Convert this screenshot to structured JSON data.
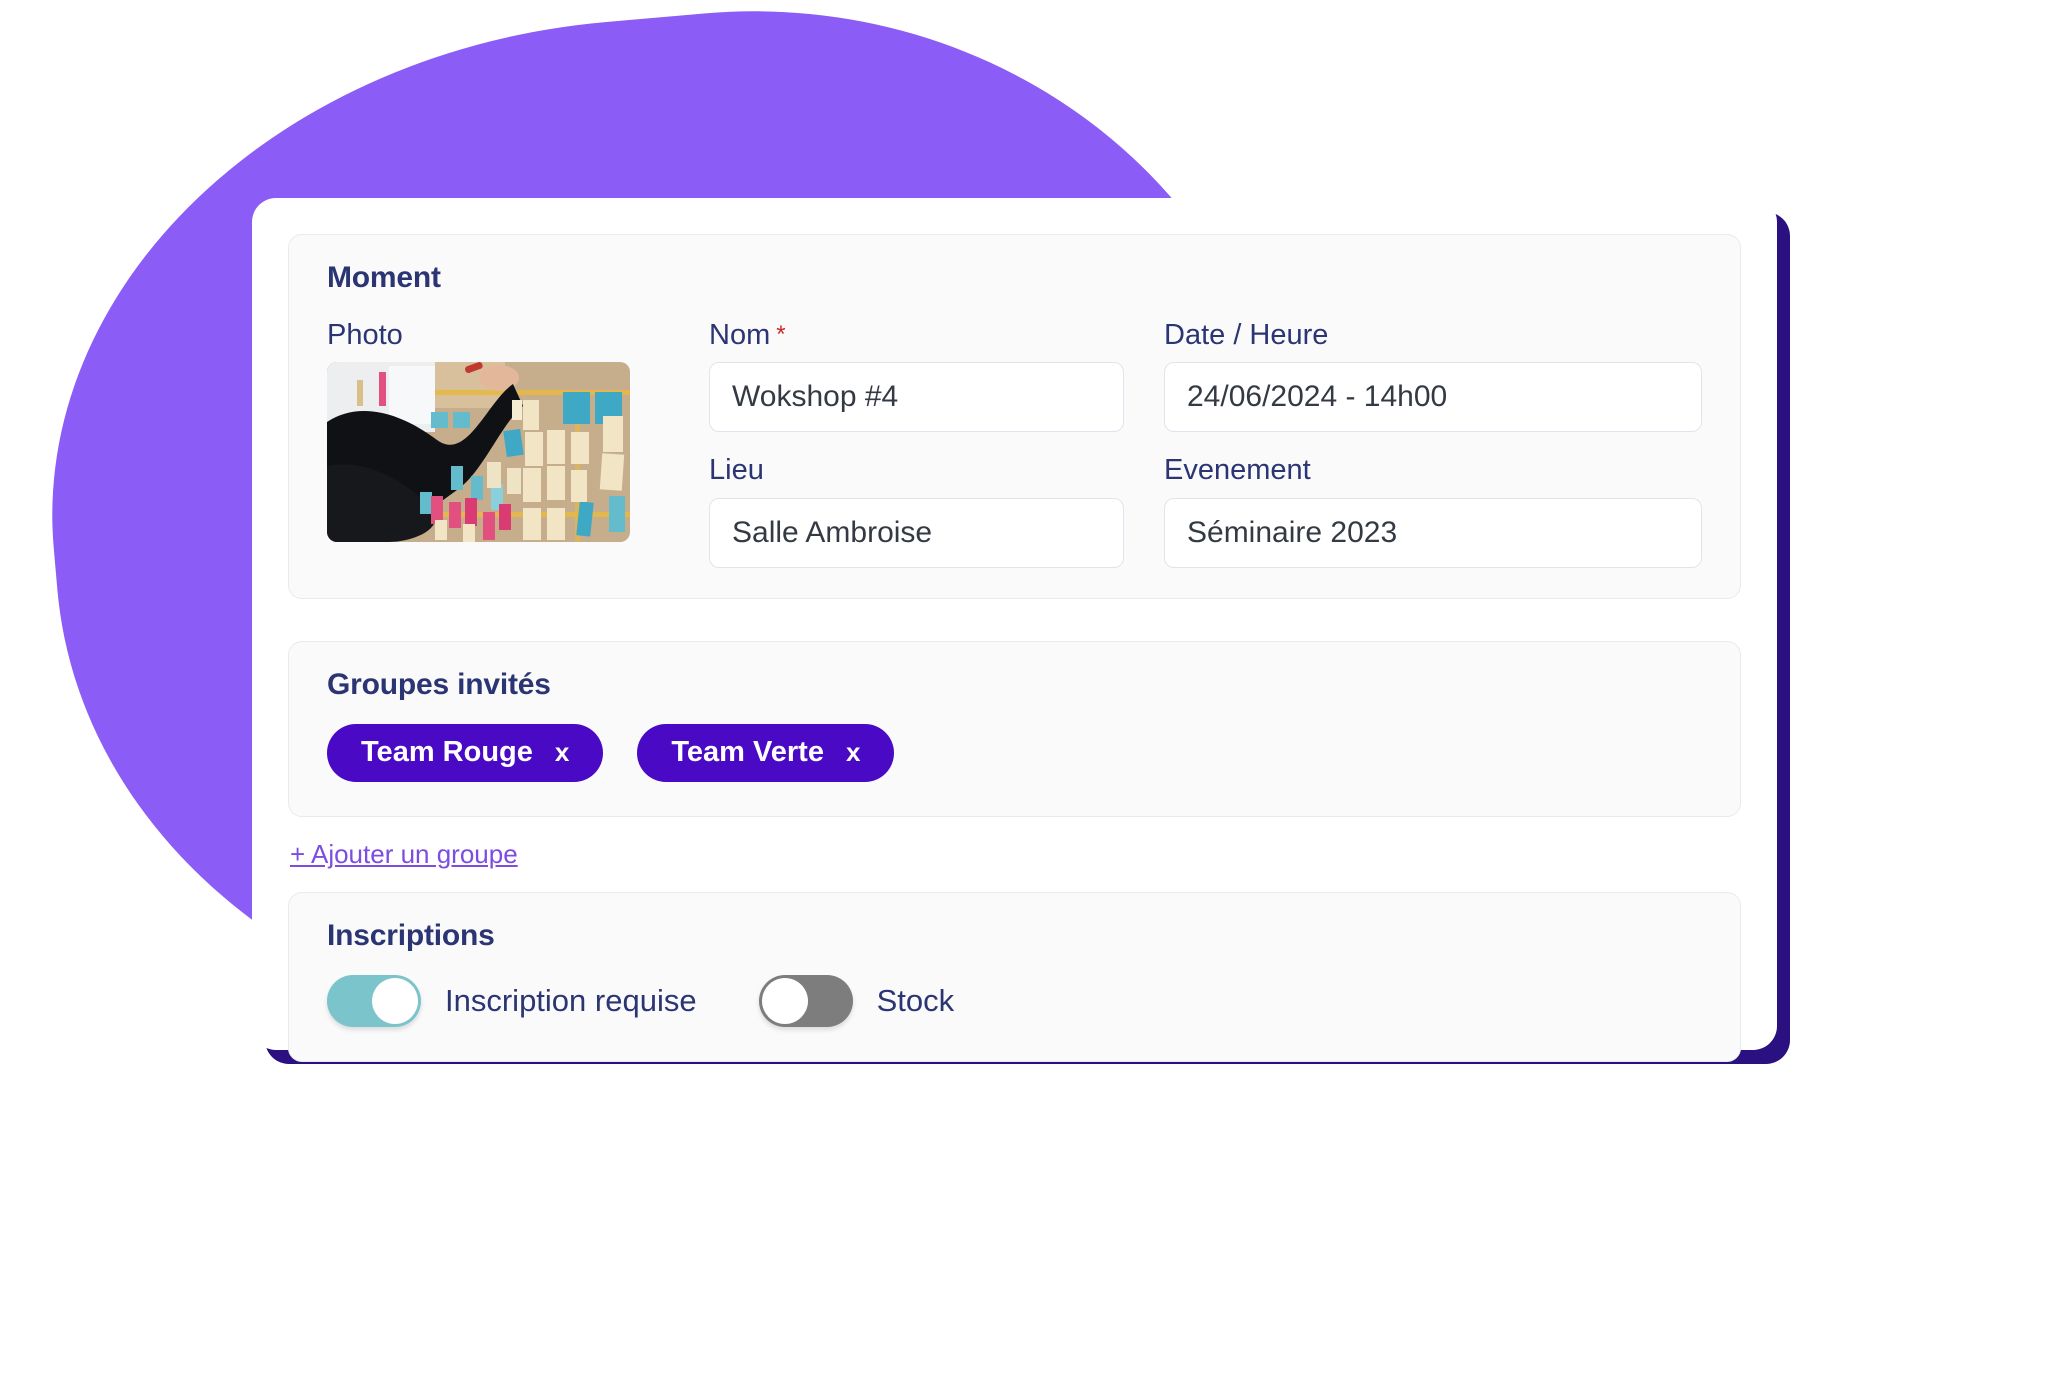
{
  "moment": {
    "title": "Moment",
    "photo_label": "Photo",
    "photo_alt": "workshop-sticky-notes-photo",
    "fields": {
      "nom": {
        "label": "Nom",
        "required_marker": "*",
        "value": "Wokshop #4"
      },
      "lieu": {
        "label": "Lieu",
        "value": "Salle Ambroise"
      },
      "date_heure": {
        "label": "Date / Heure",
        "value": "24/06/2024 - 14h00"
      },
      "evenement": {
        "label": "Evenement",
        "value": "Séminaire 2023"
      }
    }
  },
  "groupes": {
    "title": "Groupes invités",
    "tags": [
      {
        "label": "Team Rouge",
        "remove": "x"
      },
      {
        "label": "Team Verte",
        "remove": "x"
      }
    ],
    "add_link": "+ Ajouter un groupe"
  },
  "inscriptions": {
    "title": "Inscriptions",
    "toggles": [
      {
        "label": "Inscription requise",
        "state": "on"
      },
      {
        "label": "Stock",
        "state": "off"
      }
    ]
  },
  "colors": {
    "blob_purple": "#8B5CF6",
    "card_shadow": "#2A1080",
    "heading_navy": "#2B3573",
    "tag_violet": "#4A09C4",
    "link_purple": "#7C4DE0",
    "toggle_on_teal": "#7BC4CC",
    "toggle_off_gray": "#7D7D7D",
    "required_red": "#C62828",
    "panel_bg": "#FAFAFB",
    "panel_border": "#E8EAEF",
    "input_border": "#E0E4EC"
  }
}
